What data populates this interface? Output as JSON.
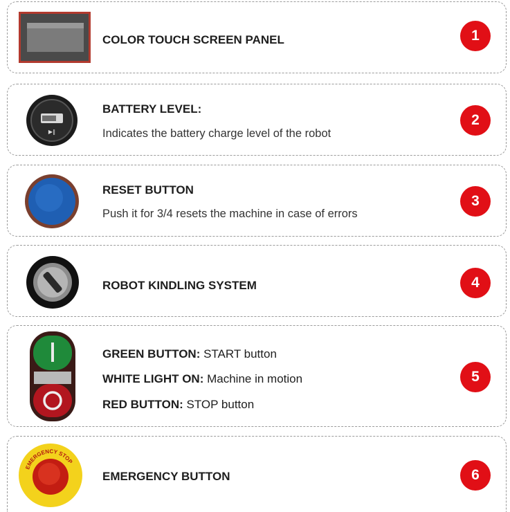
{
  "items": [
    {
      "number": "1",
      "title": "COLOR TOUCH SCREEN PANEL",
      "icon": "touch-screen-panel-icon"
    },
    {
      "number": "2",
      "title": "BATTERY LEVEL:",
      "description": "Indicates the battery charge level of the robot",
      "icon": "battery-gauge-icon"
    },
    {
      "number": "3",
      "title": "RESET BUTTON",
      "description": "Push it for 3/4 resets the machine in case of errors",
      "icon": "blue-reset-button-icon"
    },
    {
      "number": "4",
      "title": "ROBOT KINDLING SYSTEM",
      "icon": "key-switch-icon"
    },
    {
      "number": "5",
      "lines": [
        {
          "label": "GREEN BUTTON:",
          "text": " START button"
        },
        {
          "label": "WHITE LIGHT ON:",
          "text": " Machine in motion"
        },
        {
          "label": "RED BUTTON:",
          "text": " STOP button"
        }
      ],
      "icon": "start-stop-buttons-icon"
    },
    {
      "number": "6",
      "title": "EMERGENCY BUTTON",
      "icon_text": "EMERGENCY STOP",
      "icon": "emergency-stop-icon"
    }
  ],
  "colors": {
    "badge": "#e10f16"
  }
}
